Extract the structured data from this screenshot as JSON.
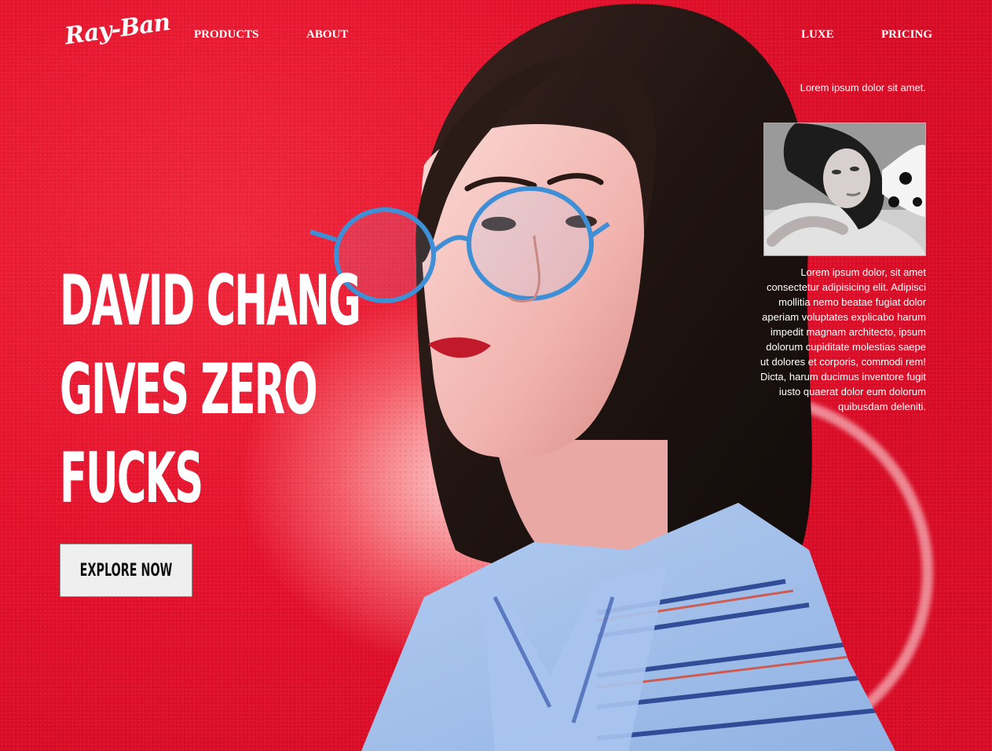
{
  "brand": {
    "logo_text": "Ray-Ban"
  },
  "nav": {
    "left": [
      {
        "label": "PRODUCTS"
      },
      {
        "label": "ABOUT"
      }
    ],
    "right": [
      {
        "label": "LUXE"
      },
      {
        "label": "PRICING"
      }
    ]
  },
  "hero": {
    "title_lines": [
      "DAVID CHANG",
      "GIVES ZERO",
      "FUCKS"
    ],
    "cta_label": "EXPLORE NOW"
  },
  "aside": {
    "tagline": "Lorem ipsum dolor sit amet.",
    "body": "Lorem ipsum dolor, sit amet consectetur adipisicing elit. Adipisci mollitia nemo beatae fugiat dolor aperiam voluptates explicabo harum impedit magnam architecto, ipsum dolorum cupiditate molestias saepe ut dolores et corporis, commodi rem! Dicta, harum ducimus inventore fugit iusto quaerat dolor eum dolorum quibusdam deleniti."
  },
  "colors": {
    "background_red": "#e4112c",
    "text_white": "#ffffff",
    "button_bg": "#efefef",
    "glasses_blue": "#3f8fd6",
    "shirt_blue": "#9bbbe8",
    "hair_dark": "#221612"
  },
  "images": {
    "hero_portrait": "woman-with-round-blue-glasses",
    "thumbnail": "woman-lying-monochrome"
  }
}
